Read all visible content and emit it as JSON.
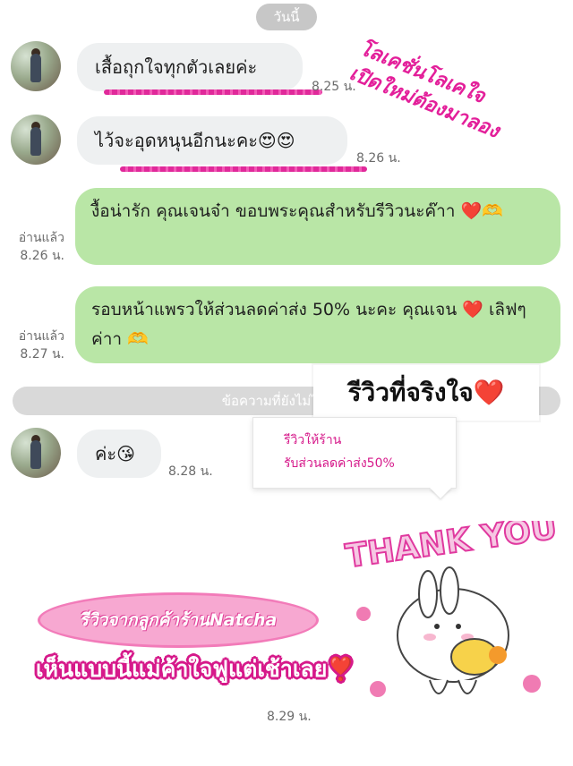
{
  "chat": {
    "date_label": "วันนี้",
    "messages": [
      {
        "text": "เสื้อถุกใจทุกตัวเลยค่ะ",
        "time": "8.25 น."
      },
      {
        "text": "ไว้จะอุดหนุนอีกนะคะ😍😍",
        "time": "8.26 น."
      },
      {
        "text": "งื้อน่ารัก คุณเจนจ๋า ขอบพระคุณสำหรับรีวิวนะค๊าา ❤️🫶",
        "read": "อ่านแล้ว",
        "time": "8.26 น."
      },
      {
        "text": "รอบหน้าแพรวให้ส่วนลดค่าส่ง 50% นะคะ คุณเจน ❤️ เลิฟๆค่าา 🫶",
        "read": "อ่านแล้ว",
        "time": "8.27 น."
      },
      {
        "text": "ค่ะ😘",
        "time": "8.28 น."
      }
    ],
    "unread_divider": "ข้อความที่ยังไม่ได้อ่าน",
    "final_time": "8.29 น."
  },
  "overlays": {
    "corner_note": [
      "โลเคชั่นโลเคใจ",
      "เปิดใหม่ต้องมาลอง"
    ],
    "review_title": "รีวิวที่จริงใจ❤️",
    "popup_lines": [
      "รีวิวให้ร้าน",
      "รับส่วนลดค่าส่ง50%"
    ],
    "oval_label": "รีวิวจากลูกค้าร้านNatcha",
    "big_caption": "เห็นแบบนี้แม่ค้าใจฟูแต่เช้าเลย❣️",
    "sticker_text": "THANK YOU!"
  }
}
